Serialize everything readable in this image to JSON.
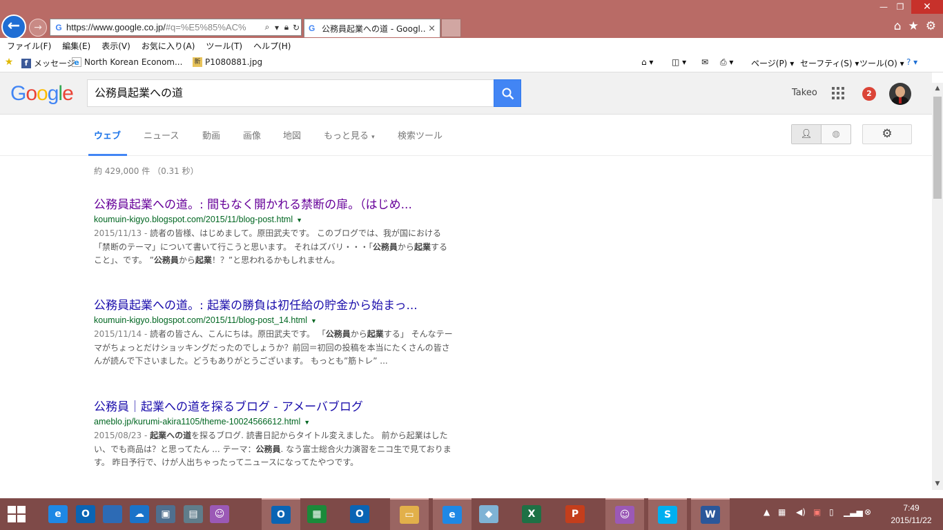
{
  "browser": {
    "address_url": "https://www.google.co.jp/",
    "address_url_rest": "#q=%E5%85%AC%",
    "tab_title": "公務員起業への道 - Googl...",
    "tab_close": "×",
    "window": {
      "minimize": "—",
      "maximize": "❐",
      "close": "✕"
    }
  },
  "menubar": [
    "ファイル(F)",
    "編集(E)",
    "表示(V)",
    "お気に入り(A)",
    "ツール(T)",
    "ヘルプ(H)"
  ],
  "favorites": [
    {
      "label": "メッセージ",
      "icon": "facebook-icon"
    },
    {
      "label": "North Korean Econom...",
      "icon": "ie-page-icon"
    },
    {
      "label": "P1080881.jpg",
      "icon": "image-file-icon"
    }
  ],
  "commandbar": {
    "page": "ページ(P)",
    "safety": "セーフティ(S)",
    "tools": "ツール(O)"
  },
  "google": {
    "logo": "Google",
    "query": "公務員起業への道",
    "user_name": "Takeo",
    "notification_count": "2",
    "nav": {
      "web": "ウェブ",
      "news": "ニュース",
      "video": "動画",
      "images": "画像",
      "maps": "地図",
      "more": "もっと見る",
      "tools": "検索ツール"
    },
    "stats": "約 429,000 件 （0.31 秒）",
    "results": [
      {
        "title": "公務員起業への道。: 間もなく開かれる禁断の扉。（はじめ...",
        "visited": true,
        "url": "koumuin-kigyo.blogspot.com/2015/11/blog-post.html",
        "date": "2015/11/13 - ",
        "snippet_parts": [
          {
            "t": "読者の皆様、はじめまして。原田武夫です。 このブログでは、我が国における「禁断のテーマ」について書いて行こうと思います。 それはズバリ・・・「",
            "b": false
          },
          {
            "t": "公務員",
            "b": true
          },
          {
            "t": "から",
            "b": false
          },
          {
            "t": "起業",
            "b": true
          },
          {
            "t": "すること」、です。 ”",
            "b": false
          },
          {
            "t": "公務員",
            "b": true
          },
          {
            "t": "から",
            "b": false
          },
          {
            "t": "起業",
            "b": true
          },
          {
            "t": "！？”と思われるかもしれません。",
            "b": false
          }
        ]
      },
      {
        "title": "公務員起業への道。: 起業の勝負は初任給の貯金から始まっ...",
        "visited": false,
        "url": "koumuin-kigyo.blogspot.com/2015/11/blog-post_14.html",
        "date": "2015/11/14 - ",
        "snippet_parts": [
          {
            "t": "読者の皆さん、こんにちは。原田武夫です。 「",
            "b": false
          },
          {
            "t": "公務員",
            "b": true
          },
          {
            "t": "から",
            "b": false
          },
          {
            "t": "起業",
            "b": true
          },
          {
            "t": "する」 そんなテーマがちょっとだけショッキングだったのでしょうか？前回＝初回の投稿を本当にたくさんの皆さんが読んで下さいました。どうもありがとうございます。 もっとも”筋トレ” ...",
            "b": false
          }
        ]
      },
      {
        "title": "公務員｜起業への道を探るブログ - アメーバブログ",
        "visited": false,
        "url": "ameblo.jp/kurumi-akira1105/theme-10024566612.html",
        "date": "2015/08/23 - ",
        "snippet_parts": [
          {
            "t": "起業への道",
            "b": true
          },
          {
            "t": "を探るブログ. 読書日記からタイトル変えました。 前から起業はしたい、でも商品は？と思ってたん ... テーマ：",
            "b": false
          },
          {
            "t": "公務員",
            "b": true
          },
          {
            "t": ". なう富士総合火力演習をニコ生で見ております。 昨日予行で、けが人出ちゃったってニュースになってたやつです。",
            "b": false
          }
        ]
      }
    ]
  },
  "taskbar": {
    "time": "7:49",
    "date": "2015/11/22",
    "apps": [
      {
        "name": "ie",
        "label": "e",
        "color": "#1e88e5"
      },
      {
        "name": "outlook",
        "label": "O",
        "color": "#0a64b4"
      },
      {
        "name": "desktop",
        "label": "",
        "color": "#2d6bb5"
      },
      {
        "name": "onedrive",
        "label": "☁",
        "color": "#1a73c9"
      },
      {
        "name": "remote",
        "label": "▣",
        "color": "#4f6f8f"
      },
      {
        "name": "network",
        "label": "▤",
        "color": "#607d8b"
      },
      {
        "name": "messenger",
        "label": "☺",
        "color": "#9b59b6"
      },
      {
        "name": "outlook-mail",
        "label": "O",
        "color": "#0a64b4"
      },
      {
        "name": "store",
        "label": "▦",
        "color": "#1b8a3a"
      },
      {
        "name": "outlook2",
        "label": "O",
        "color": "#0a64b4"
      },
      {
        "name": "explorer",
        "label": "▭",
        "color": "#e2b04a"
      },
      {
        "name": "ie-active",
        "label": "e",
        "color": "#1e88e5"
      },
      {
        "name": "notes",
        "label": "◆",
        "color": "#7fb3d5"
      },
      {
        "name": "excel",
        "label": "X",
        "color": "#1e7145"
      },
      {
        "name": "powerpoint",
        "label": "P",
        "color": "#c43e1c"
      },
      {
        "name": "messenger2",
        "label": "☺",
        "color": "#9b59b6"
      },
      {
        "name": "skype",
        "label": "S",
        "color": "#00aff0"
      },
      {
        "name": "word",
        "label": "W",
        "color": "#2b579a"
      }
    ]
  }
}
